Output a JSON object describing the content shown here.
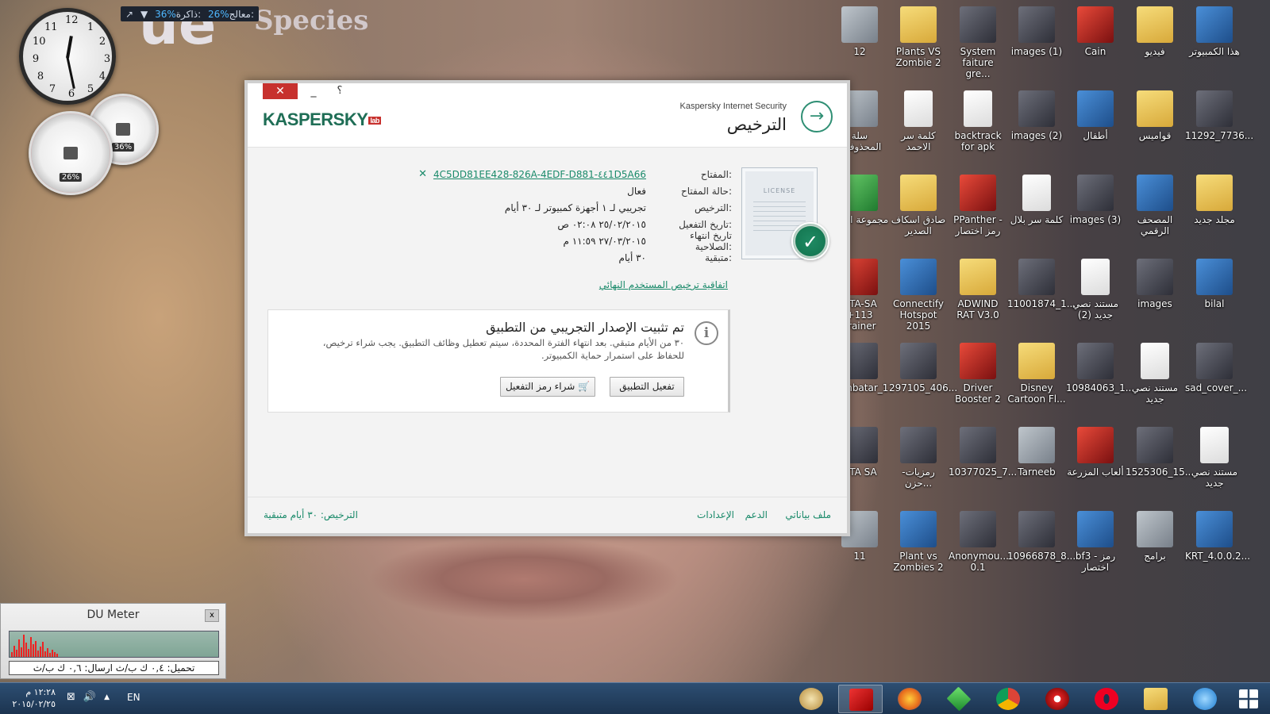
{
  "wallpaper": {
    "text_species": "Species",
    "text_big": "ue"
  },
  "perf_gadget": {
    "cpu_label": "معالج:",
    "cpu_value": "26%",
    "mem_label": "ذاكرة:",
    "mem_value": "36%"
  },
  "gauges": {
    "cpu": "26%",
    "mem": "36%"
  },
  "desktop_icons": [
    {
      "label": "هذا الكمبيوتر",
      "type": "app"
    },
    {
      "label": "فيديو",
      "type": "folder"
    },
    {
      "label": "Cain",
      "type": "red"
    },
    {
      "label": "images (1)",
      "type": "photo"
    },
    {
      "label": "System faiture gre...",
      "type": "photo"
    },
    {
      "label": "Plants VS Zombie 2",
      "type": "folder"
    },
    {
      "label": "12",
      "type": "gray"
    },
    {
      "label": "11292_7736...",
      "type": "photo"
    },
    {
      "label": "قواميس",
      "type": "folder"
    },
    {
      "label": "أطفال",
      "type": "app"
    },
    {
      "label": "images (2)",
      "type": "photo"
    },
    {
      "label": "backtrack for apk",
      "type": "doc"
    },
    {
      "label": "كلمة سر الاحمد",
      "type": "doc"
    },
    {
      "label": "سلة المحذوفات",
      "type": "gray"
    },
    {
      "label": "مجلد جديد",
      "type": "folder"
    },
    {
      "label": "المصحف الرقمي",
      "type": "app"
    },
    {
      "label": "images (3)",
      "type": "photo"
    },
    {
      "label": "كلمة سر بلال",
      "type": "doc"
    },
    {
      "label": "PPanther - رمز اختصار",
      "type": "red"
    },
    {
      "label": "صادق اسكاف الصدير",
      "type": "folder"
    },
    {
      "label": "مجموعة العاب",
      "type": "green"
    },
    {
      "label": "bilal",
      "type": "app"
    },
    {
      "label": "images",
      "type": "photo"
    },
    {
      "label": "مستند نصي جديد (2)",
      "type": "doc"
    },
    {
      "label": "11001874_1...",
      "type": "photo"
    },
    {
      "label": "ADWIND RAT V3.0",
      "type": "folder"
    },
    {
      "label": "Connectify Hotspot 2015",
      "type": "app"
    },
    {
      "label": "GTA-SA +113 Trainer",
      "type": "red"
    },
    {
      "label": "sad_cover_...",
      "type": "photo"
    },
    {
      "label": "مستند نصي جديد",
      "type": "doc"
    },
    {
      "label": "10984063_1...",
      "type": "photo"
    },
    {
      "label": "Disney Cartoon Fl...",
      "type": "folder"
    },
    {
      "label": "Driver Booster 2",
      "type": "red"
    },
    {
      "label": "297105_406...",
      "type": "photo"
    },
    {
      "label": "Zombatar_1",
      "type": "photo"
    },
    {
      "label": "مستند نصي جديد",
      "type": "doc"
    },
    {
      "label": "1525306_15...",
      "type": "photo"
    },
    {
      "label": "ألعاب المزرعة",
      "type": "red"
    },
    {
      "label": "Tarneeb",
      "type": "gray"
    },
    {
      "label": "10377025_7...",
      "type": "photo"
    },
    {
      "label": "رمزيات-حزن...",
      "type": "photo"
    },
    {
      "label": "GTA SA",
      "type": "photo"
    },
    {
      "label": "KRT_4.0.0.2...",
      "type": "app"
    },
    {
      "label": "برامج",
      "type": "gray"
    },
    {
      "label": "bf3 - رمز اختصار",
      "type": "app"
    },
    {
      "label": "10966878_8...",
      "type": "photo"
    },
    {
      "label": "Anonymou... 0.1",
      "type": "photo"
    },
    {
      "label": "Plant vs Zombies 2",
      "type": "app"
    },
    {
      "label": "11",
      "type": "gray"
    }
  ],
  "kaspersky": {
    "close": "✕",
    "minimize": "_",
    "help": "؟",
    "logo": "KASPERSKY",
    "logo_lab": "lab",
    "product": "Kaspersky Internet Security",
    "title": "الترخيص",
    "back": "→",
    "fields": [
      {
        "label": "المفتاح:",
        "value": "4C5DD81EE428-826A-4EDF-D881-٤٤1D5A66",
        "link": true
      },
      {
        "label": "حالة المفتاح:",
        "value": "فعال"
      },
      {
        "label": "الترخيص:",
        "value": "تجريبي لـ ١ أجهزة كمبيوتر لـ ٣٠ أيام"
      },
      {
        "label": "تاريخ التفعيل:",
        "value": "٢٥/٠٢/٢٠١٥ ٠٢:٠٨ ص"
      },
      {
        "label": "تاريخ انتهاء الصلاحية:",
        "value": "٢٧/٠٣/٢٠١٥ ١١:٥٩ م"
      },
      {
        "label": "متبقية:",
        "value": "٣٠ أيام"
      }
    ],
    "key_remove": "✕",
    "license_card_text": "LICENSE",
    "eula": "اتفاقية ترخيص المستخدم النهائي",
    "info": {
      "icon": "i",
      "heading": "تم تثبيت الإصدار التجريبي من التطبيق",
      "body": "٣٠ من الأيام متبقي. بعد انتهاء الفترة المحددة، سيتم تعطيل وظائف التطبيق. يجب شراء ترخيص، للحفاظ على استمرار حماية الكمبيوتر.",
      "activate": "تفعيل التطبيق",
      "buy": "شراء رمز التفعيل"
    },
    "footer": {
      "profile": "ملف بياناتي",
      "support": "الدعم",
      "settings": "الإعدادات",
      "license_status": "الترخيص: ٣٠ أيام متبقية"
    }
  },
  "du_meter": {
    "title": "DU Meter",
    "close": "x",
    "rates": "تحميل: ٠,٤ ك ب/ث   ارسال: ٠,٦ ك ب/ث"
  },
  "taskbar": {
    "time": "١٢:٢٨ م",
    "date": "٢٠١٥/٠٢/٢٥",
    "lang": "EN",
    "tray_up": "▲",
    "volume": "🔊"
  }
}
